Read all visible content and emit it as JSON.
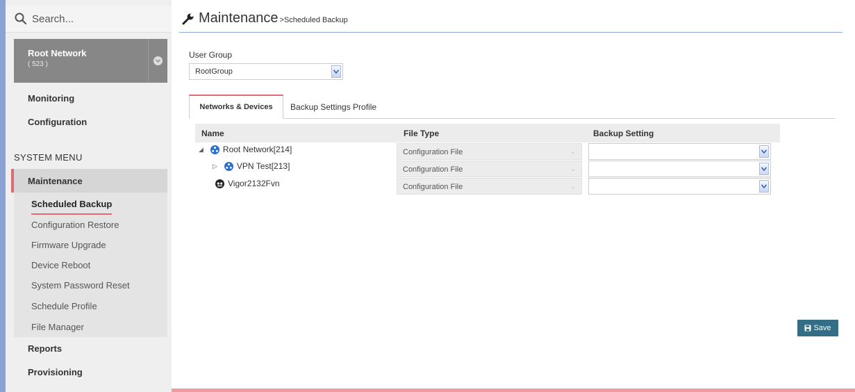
{
  "sidebar": {
    "search_placeholder": "Search...",
    "network": {
      "name": "Root Network",
      "count": "( 523 )"
    },
    "top_items": [
      "Monitoring",
      "Configuration"
    ],
    "system_menu_label": "SYSTEM MENU",
    "maintenance_label": "Maintenance",
    "maintenance_items": [
      "Scheduled Backup",
      "Configuration Restore",
      "Firmware Upgrade",
      "Device Reboot",
      "System Password Reset",
      "Schedule Profile",
      "File Manager"
    ],
    "bottom_items": [
      "Reports",
      "Provisioning"
    ]
  },
  "header": {
    "title": "Maintenance",
    "breadcrumb": ">Scheduled Backup"
  },
  "user_group": {
    "label": "User Group",
    "value": "RootGroup"
  },
  "tabs": [
    {
      "label": "Networks & Devices",
      "active": true
    },
    {
      "label": "Backup Settings Profile",
      "active": false
    }
  ],
  "table": {
    "columns": [
      "Name",
      "File Type",
      "Backup Setting"
    ],
    "rows": [
      {
        "name": "Root Network[214]",
        "file_type": "Configuration File",
        "backup_setting": ""
      },
      {
        "name": "VPN Test[213]",
        "file_type": "Configuration File",
        "backup_setting": ""
      },
      {
        "name": "Vigor2132Fvn",
        "file_type": "Configuration File",
        "backup_setting": ""
      }
    ]
  },
  "save_label": "Save",
  "colors": {
    "accent_red": "#e06a73",
    "save_button": "#336e86",
    "network_icon": "#2a6fc9",
    "sidebar_bg": "#efefef"
  }
}
